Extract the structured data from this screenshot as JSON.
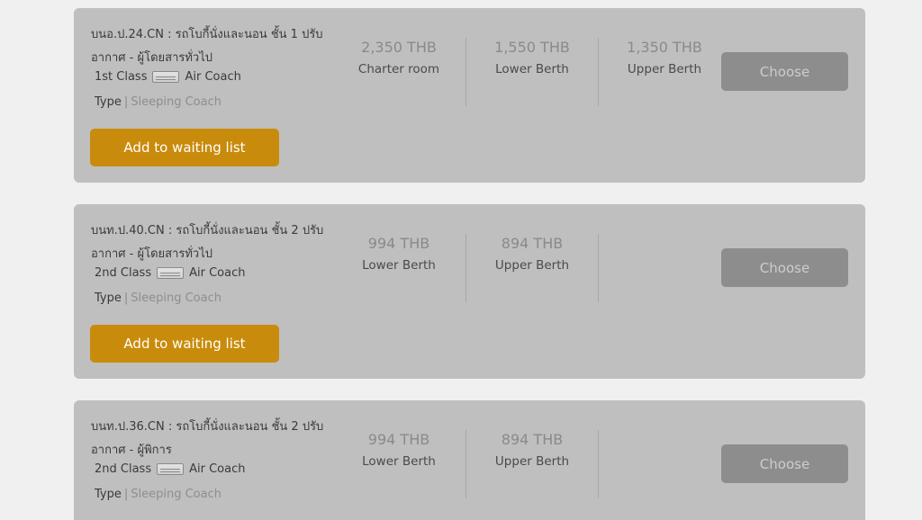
{
  "trips": [
    {
      "title": "บนอ.ป.24.CN : รถโบกี้นั่งและนอน ชั้น 1 ปรับอากาศ - ผู้โดยสารทั่วไป",
      "class_label": "1st Class",
      "coach_label": "Air Coach",
      "coach_icon": "air-conditioner-icon",
      "type_label": "Type",
      "type_value": "Sleeping Coach",
      "waiting_label": "Add to waiting list",
      "choose_label": "Choose",
      "prices": [
        {
          "amount": "2,350 THB",
          "label": "Charter room"
        },
        {
          "amount": "1,550 THB",
          "label": "Lower Berth"
        },
        {
          "amount": "1,350 THB",
          "label": "Upper Berth"
        }
      ]
    },
    {
      "title": "บนท.ป.40.CN : รถโบกี้นั่งและนอน ชั้น 2 ปรับอากาศ - ผู้โดยสารทั่วไป",
      "class_label": "2nd Class",
      "coach_label": "Air Coach",
      "coach_icon": "air-conditioner-icon",
      "type_label": "Type",
      "type_value": "Sleeping Coach",
      "waiting_label": "Add to waiting list",
      "choose_label": "Choose",
      "prices": [
        {
          "amount": "994 THB",
          "label": "Lower Berth"
        },
        {
          "amount": "894 THB",
          "label": "Upper Berth"
        }
      ]
    },
    {
      "title": "บนท.ป.36.CN : รถโบกี้นั่งและนอน ชั้น 2 ปรับอากาศ - ผู้พิการ",
      "class_label": "2nd Class",
      "coach_label": "Air Coach",
      "coach_icon": "air-conditioner-icon",
      "type_label": "Type",
      "type_value": "Sleeping Coach",
      "choose_label": "Choose",
      "prices": [
        {
          "amount": "994 THB",
          "label": "Lower Berth"
        },
        {
          "amount": "894 THB",
          "label": "Upper Berth"
        }
      ]
    }
  ],
  "colors": {
    "card_bg": "#bfbfbf",
    "waiting_button": "#c98b0b",
    "choose_button": "#8d8d8d",
    "page_bg": "#f0f0f0"
  }
}
